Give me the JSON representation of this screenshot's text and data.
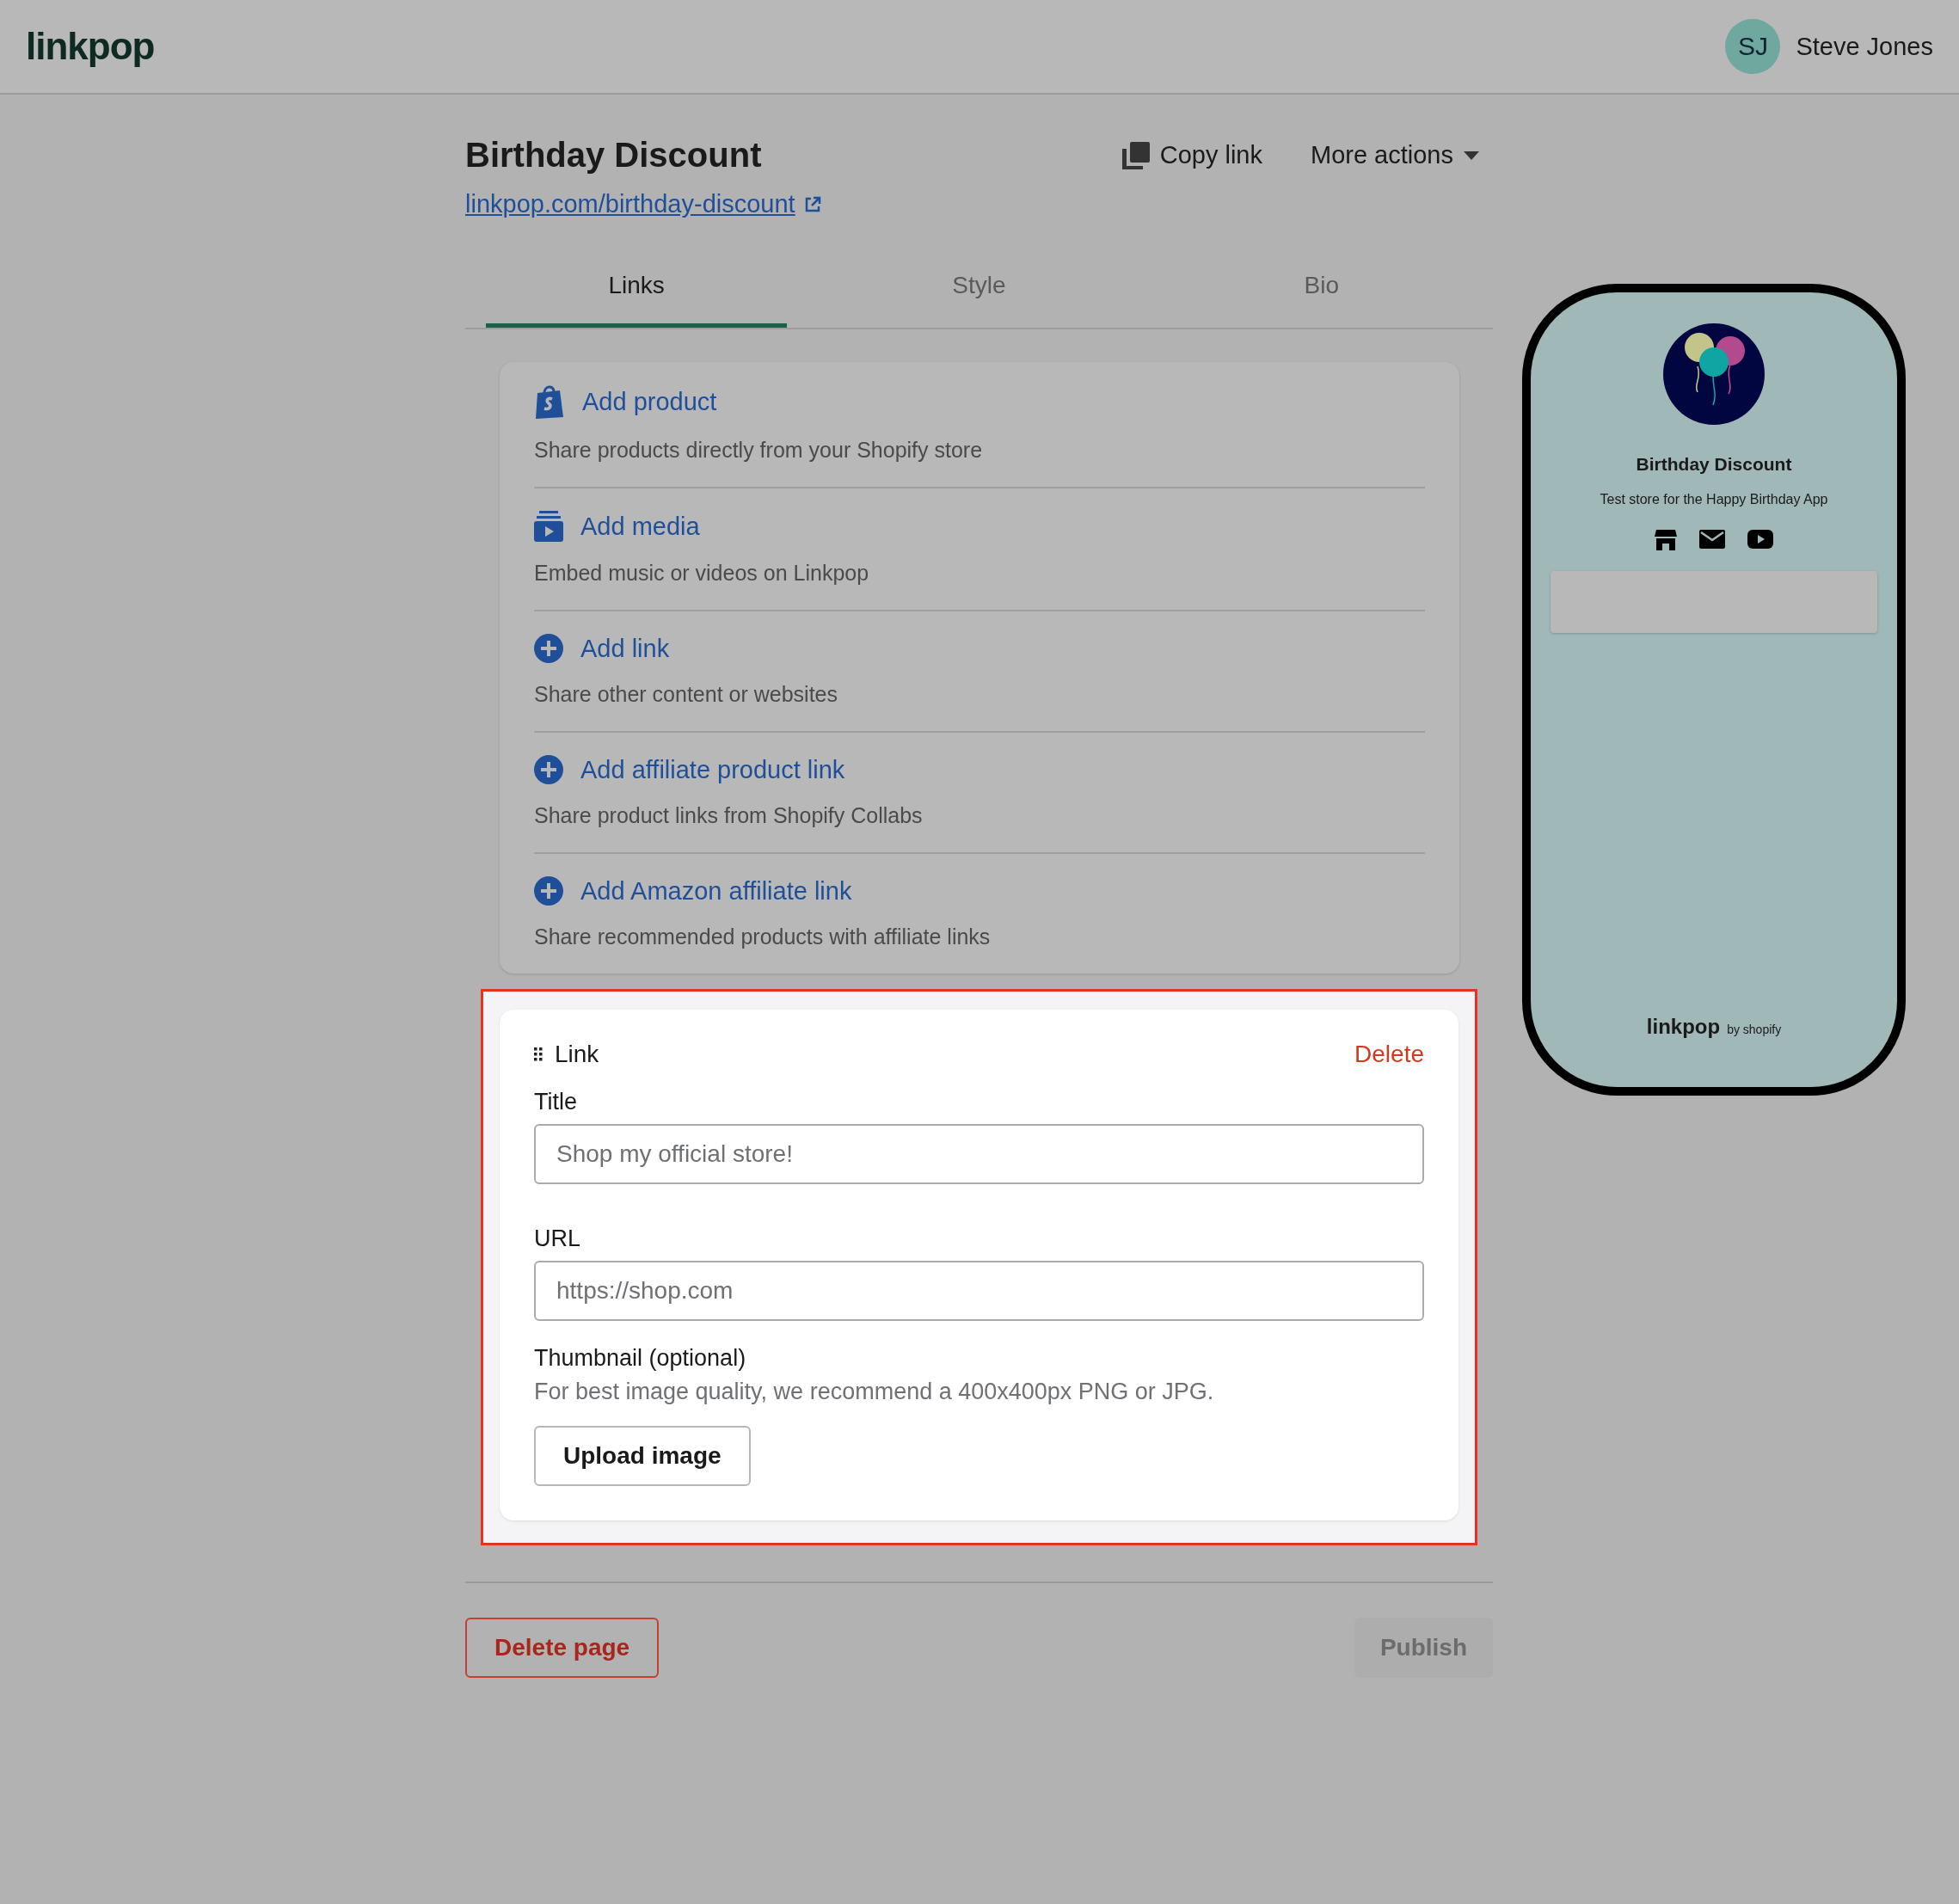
{
  "header": {
    "logo": "linkpop",
    "user": {
      "initials": "SJ",
      "name": "Steve Jones"
    }
  },
  "page": {
    "title": "Birthday Discount",
    "url": "linkpop.com/birthday-discount",
    "actions": [
      {
        "kind": "copy",
        "label": "Copy link"
      },
      {
        "kind": "menu",
        "label": "More actions"
      }
    ]
  },
  "tabs": [
    {
      "label": "Links",
      "selected": true
    },
    {
      "label": "Style",
      "selected": false
    },
    {
      "label": "Bio",
      "selected": false
    }
  ],
  "add_options": [
    {
      "kind": "product",
      "label": "Add product",
      "description": "Share products directly from your Shopify store"
    },
    {
      "kind": "media",
      "label": "Add media",
      "description": "Embed music or videos on Linkpop"
    },
    {
      "kind": "plus",
      "label": "Add link",
      "description": "Share other content or websites"
    },
    {
      "kind": "plus",
      "label": "Add affiliate product link",
      "description": "Share product links from Shopify Collabs"
    },
    {
      "kind": "plus",
      "label": "Add Amazon affiliate link",
      "description": "Share recommended products with affiliate links"
    }
  ],
  "link_editor": {
    "heading": "Link",
    "delete_label": "Delete",
    "fields": [
      {
        "label": "Title",
        "placeholder": "Shop my official store!"
      },
      {
        "label": "URL",
        "placeholder": "https://shop.com"
      }
    ],
    "thumbnail": {
      "label": "Thumbnail (optional)",
      "hint": "For best image quality, we recommend a 400x400px PNG or JPG.",
      "button": "Upload image"
    }
  },
  "footer": {
    "delete_button": "Delete page",
    "publish_button": "Publish",
    "publish_disabled": true
  },
  "preview": {
    "title": "Birthday Discount",
    "bio": "Test store for the Happy Birthday App",
    "social_icons": [
      {
        "kind": "store"
      },
      {
        "kind": "email"
      },
      {
        "kind": "youtube"
      }
    ],
    "brand": "linkpop",
    "brand_suffix": "by shopify"
  }
}
